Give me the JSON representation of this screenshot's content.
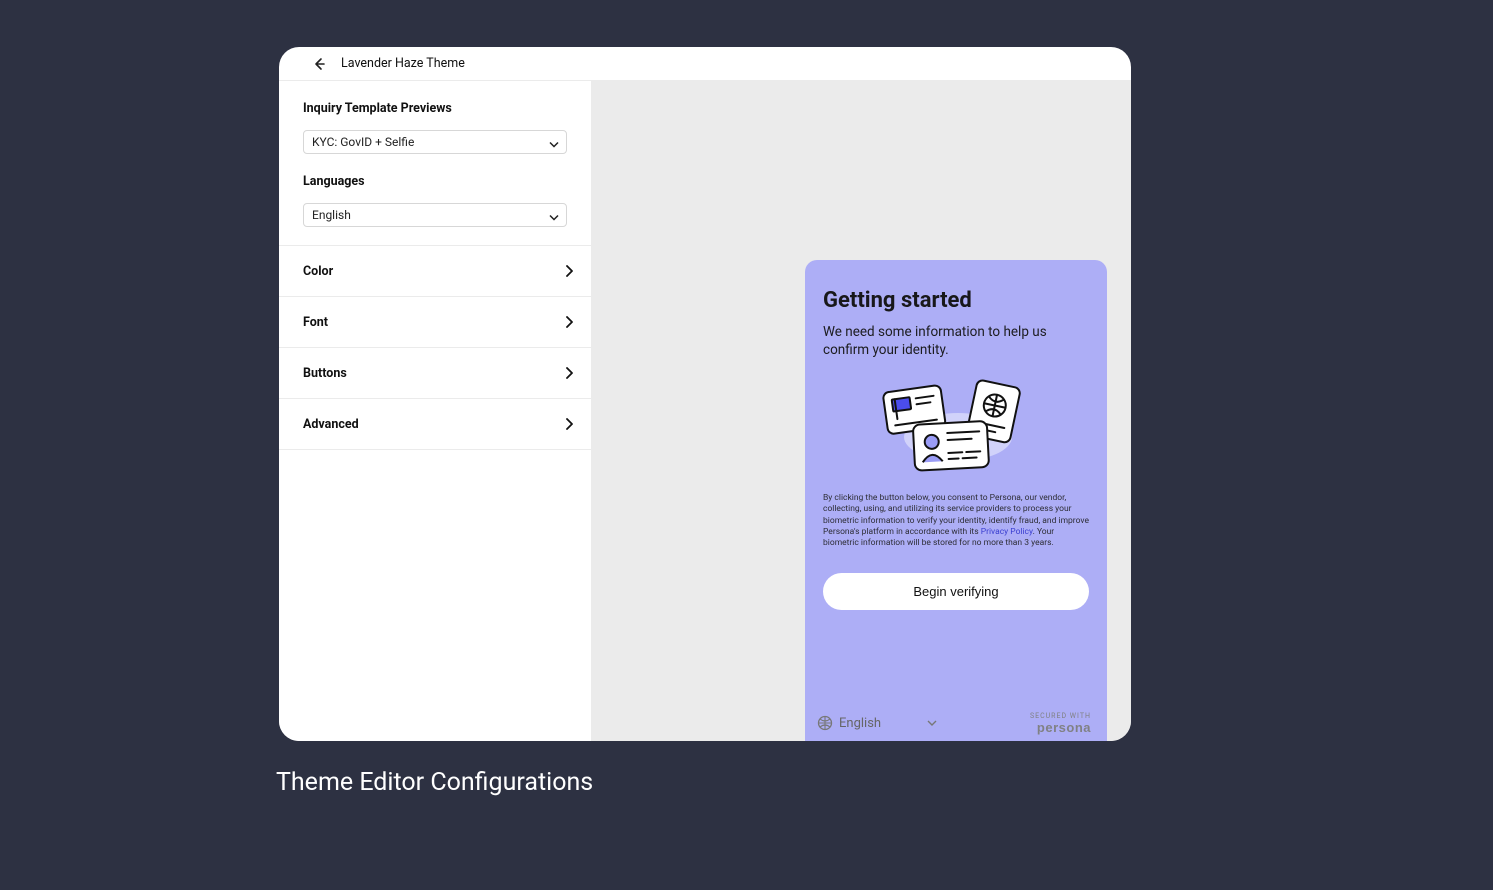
{
  "header": {
    "title": "Lavender Haze Theme"
  },
  "sidebar": {
    "templates_label": "Inquiry Template Previews",
    "template_value": "KYC: GovID + Selfie",
    "languages_label": "Languages",
    "language_value": "English",
    "sections": [
      {
        "label": "Color"
      },
      {
        "label": "Font"
      },
      {
        "label": "Buttons"
      },
      {
        "label": "Advanced"
      }
    ]
  },
  "preview": {
    "title": "Getting started",
    "subtitle": "We need some information to help us confirm your identity.",
    "consent_pre": "By clicking the button below, you consent to Persona, our vendor, collecting, using, and utilizing its service providers to process your biometric information to verify your identity, identify fraud, and improve Persona's platform in accordance with its ",
    "consent_link": "Privacy Policy",
    "consent_post": ". Your biometric information will be stored for no more than 3 years.",
    "cta": "Begin verifying",
    "footer_language": "English",
    "secured_label": "SECURED WITH",
    "brand": "persona"
  },
  "caption": "Theme Editor Configurations"
}
